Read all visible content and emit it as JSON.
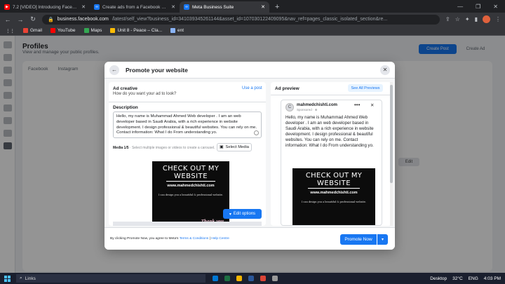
{
  "browser": {
    "tabs": [
      {
        "title": "7.2 [VIDEO] Introducing Facebook",
        "icon": "youtube-icon",
        "active": false
      },
      {
        "title": "Create ads from a Facebook Page",
        "icon": "meta-icon",
        "active": false
      },
      {
        "title": "Meta Business Suite",
        "icon": "meta-icon",
        "active": true
      }
    ],
    "url_host": "business.facebook.com",
    "url_rest": "/latest/self_view?business_id=341039345261144&asset_id=107030122409095&nav_ref=pages_classic_isolated_section&re...",
    "bookmarks": [
      {
        "label": "Gmail",
        "color": "#ea4335"
      },
      {
        "label": "YouTube",
        "color": "#ff0000"
      },
      {
        "label": "Maps",
        "color": "#34a853"
      },
      {
        "label": "Unit 8 - Peace – Cla...",
        "color": "#fbbc05"
      },
      {
        "label": "ent",
        "color": "#8ab4f8"
      }
    ]
  },
  "background": {
    "title": "Profiles",
    "subtitle": "View and manage your public profiles.",
    "tabs": [
      "Facebook",
      "Instagram"
    ],
    "create_post": "Create Post",
    "create_ad": "Create Ad",
    "edit": "Edit"
  },
  "modal": {
    "title": "Promote your website",
    "ad_creative": {
      "heading": "Ad creative",
      "question": "How do you want your ad to look?",
      "use_post": "Use a post"
    },
    "description": {
      "label": "Description",
      "text": "Hello, my name is Muhammad Ahmed Web developer . I am an web developer based in Saudi Arabia, with a rich experience in website development. I design professional & beautiful websites. You can rely on me. Contact information: What I do From understanding yo."
    },
    "media": {
      "label": "Media 1/5",
      "hint": "· Select multiple images or videos to create a carousel.",
      "select_label": "Select Media"
    },
    "ad_image": {
      "line1": "CHECK OUT MY",
      "line2": "WEBSITE",
      "url": "www.mahmedchishti.com",
      "tagline": "I can design you a beautiful & professional website.",
      "thanks": "Thank you."
    },
    "edit_options": "Edit options",
    "preview": {
      "heading": "Ad preview",
      "see_all": "See All Previews",
      "page_name": "mahmedchishti.com",
      "sponsored": "Sponsored · ⊕",
      "text": "Hello, my name is Muhammad Ahmed Web developer . I am an web developer based in Saudi Arabia, with a rich experience in website development. I design professional & beautiful websites. You can rely on me. Contact information: What I do From understanding yo."
    },
    "footer": {
      "consent_prefix": "By clicking Promote Now, you agree to Meta's",
      "terms": "Terms & Conditions",
      "separator": "|",
      "help": "Help Centre",
      "promote": "Promote Now"
    }
  },
  "taskbar": {
    "search": "Links",
    "desktop": "Desktop",
    "temp": "32°C",
    "lang": "ENG",
    "time": "4:03 PM"
  }
}
